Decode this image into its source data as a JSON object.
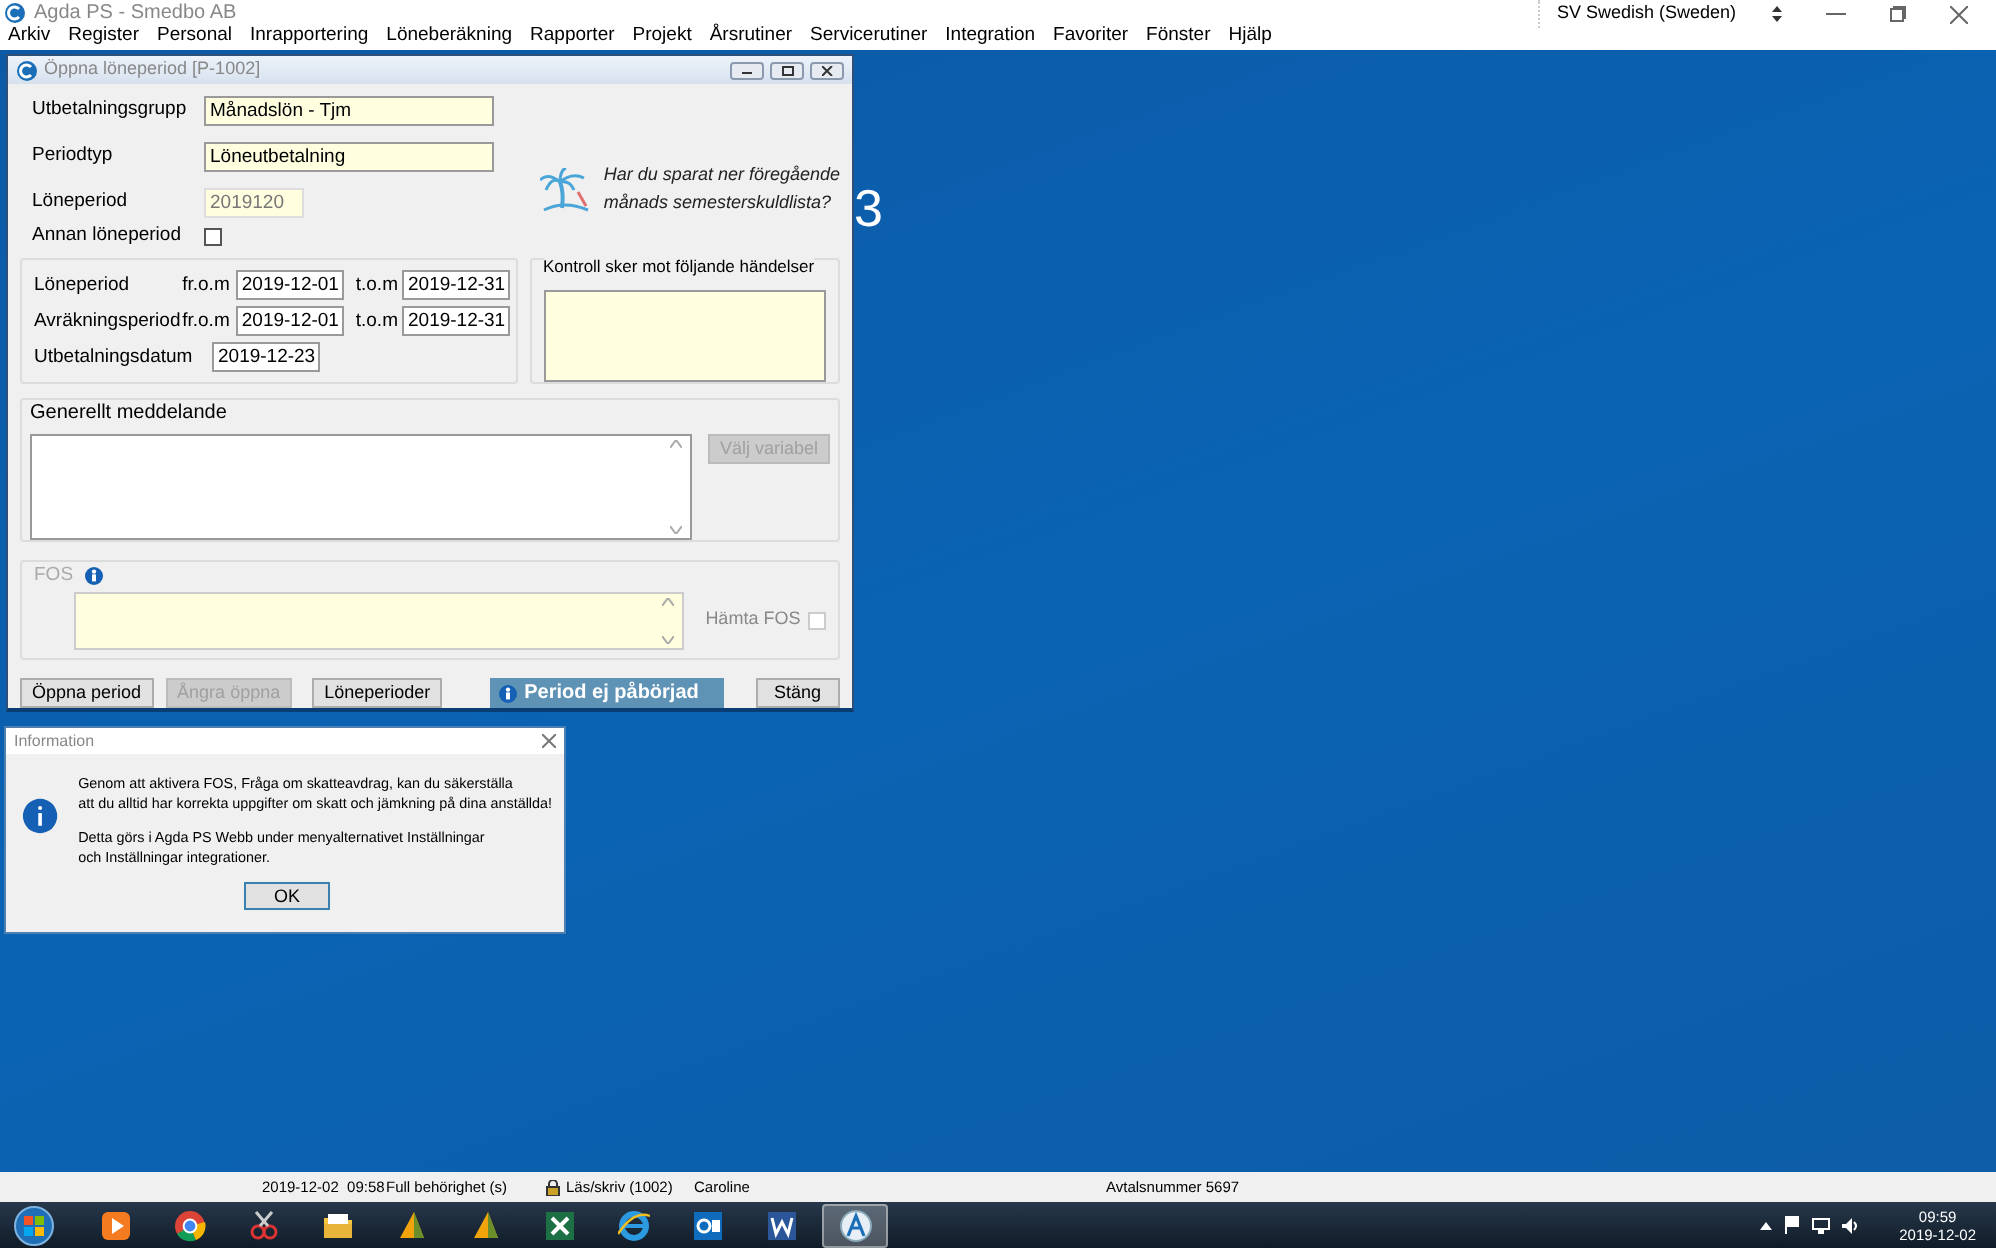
{
  "app": {
    "title": "Agda PS - Smedbo AB",
    "language": "SV Swedish (Sweden)",
    "menu": [
      "Arkiv",
      "Register",
      "Personal",
      "Inrapportering",
      "Löneberäkning",
      "Rapporter",
      "Projekt",
      "Årsrutiner",
      "Servicerutiner",
      "Integration",
      "Favoriter",
      "Fönster",
      "Hjälp"
    ]
  },
  "desktop_text": "3",
  "dialog": {
    "title": "Öppna löneperiod [P-1002]",
    "fields": [
      {
        "label": "Utbetalningsgrupp",
        "value": "Månadslön - Tjm"
      },
      {
        "label": "Periodtyp",
        "value": "Löneutbetalning"
      }
    ],
    "pay_period": {
      "label": "Löneperiod",
      "value": "2019120",
      "disabled": true
    },
    "other_period": {
      "label": "Annan löneperiod",
      "checked": false
    },
    "reminder": "Har du sparat ner föregående\nmånads semesterskuldlista?",
    "period_rows": [
      {
        "label": "Löneperiod",
        "from_label": "fr.o.m",
        "from": "2019-12-01",
        "to_label": "t.o.m",
        "to": "2019-12-31"
      },
      {
        "label": "Avräkningsperiod",
        "from_label": "fr.o.m",
        "from": "2019-12-01",
        "to_label": "t.o.m",
        "to": "2019-12-31"
      }
    ],
    "payment_date": {
      "label": "Utbetalningsdatum",
      "value": "2019-12-23"
    },
    "events_title": "Kontroll sker mot följande händelser",
    "message": {
      "title": "Generellt meddelande",
      "button": {
        "label": "Välj variabel",
        "disabled": true
      }
    },
    "fos": {
      "label": "FOS",
      "disabled": true,
      "fetch_label": "Hämta FOS",
      "fetch_checked": false
    },
    "buttons": [
      {
        "label": "Öppna period",
        "disabled": false
      },
      {
        "label": "Ångra öppna",
        "disabled": true
      },
      {
        "label": "Löneperioder",
        "disabled": false
      }
    ],
    "status": "Period ej påbörjad",
    "close_button": "Stäng"
  },
  "info_dialog": {
    "title": "Information",
    "paragraphs": [
      "Genom att aktivera FOS, Fråga om skatteavdrag, kan du säkerställa\natt du alltid har korrekta uppgifter om skatt och jämkning på dina anställda!",
      "Detta görs i Agda PS Webb under menyalternativet Inställningar\noch Inställningar integrationer."
    ],
    "button": "OK"
  },
  "status_bar": {
    "datetime": "2019-12-02  09:58",
    "access": "Full behörighet (s)",
    "mode": "Läs/skriv (1002)",
    "user": "Caroline",
    "contract": "Avtalsnummer 5697"
  },
  "taskbar": {
    "apps": [
      {
        "kind": "media",
        "active": false
      },
      {
        "kind": "chrome",
        "active": false
      },
      {
        "kind": "scissors",
        "active": false
      },
      {
        "kind": "folder",
        "active": false
      },
      {
        "kind": "triangle",
        "active": false
      },
      {
        "kind": "triangle",
        "active": false
      },
      {
        "kind": "excel",
        "active": false
      },
      {
        "kind": "ie",
        "active": false
      },
      {
        "kind": "outlook",
        "active": false
      },
      {
        "kind": "word",
        "active": false
      },
      {
        "kind": "agda",
        "active": true
      }
    ],
    "time": "09:59",
    "date": "2019-12-02"
  }
}
